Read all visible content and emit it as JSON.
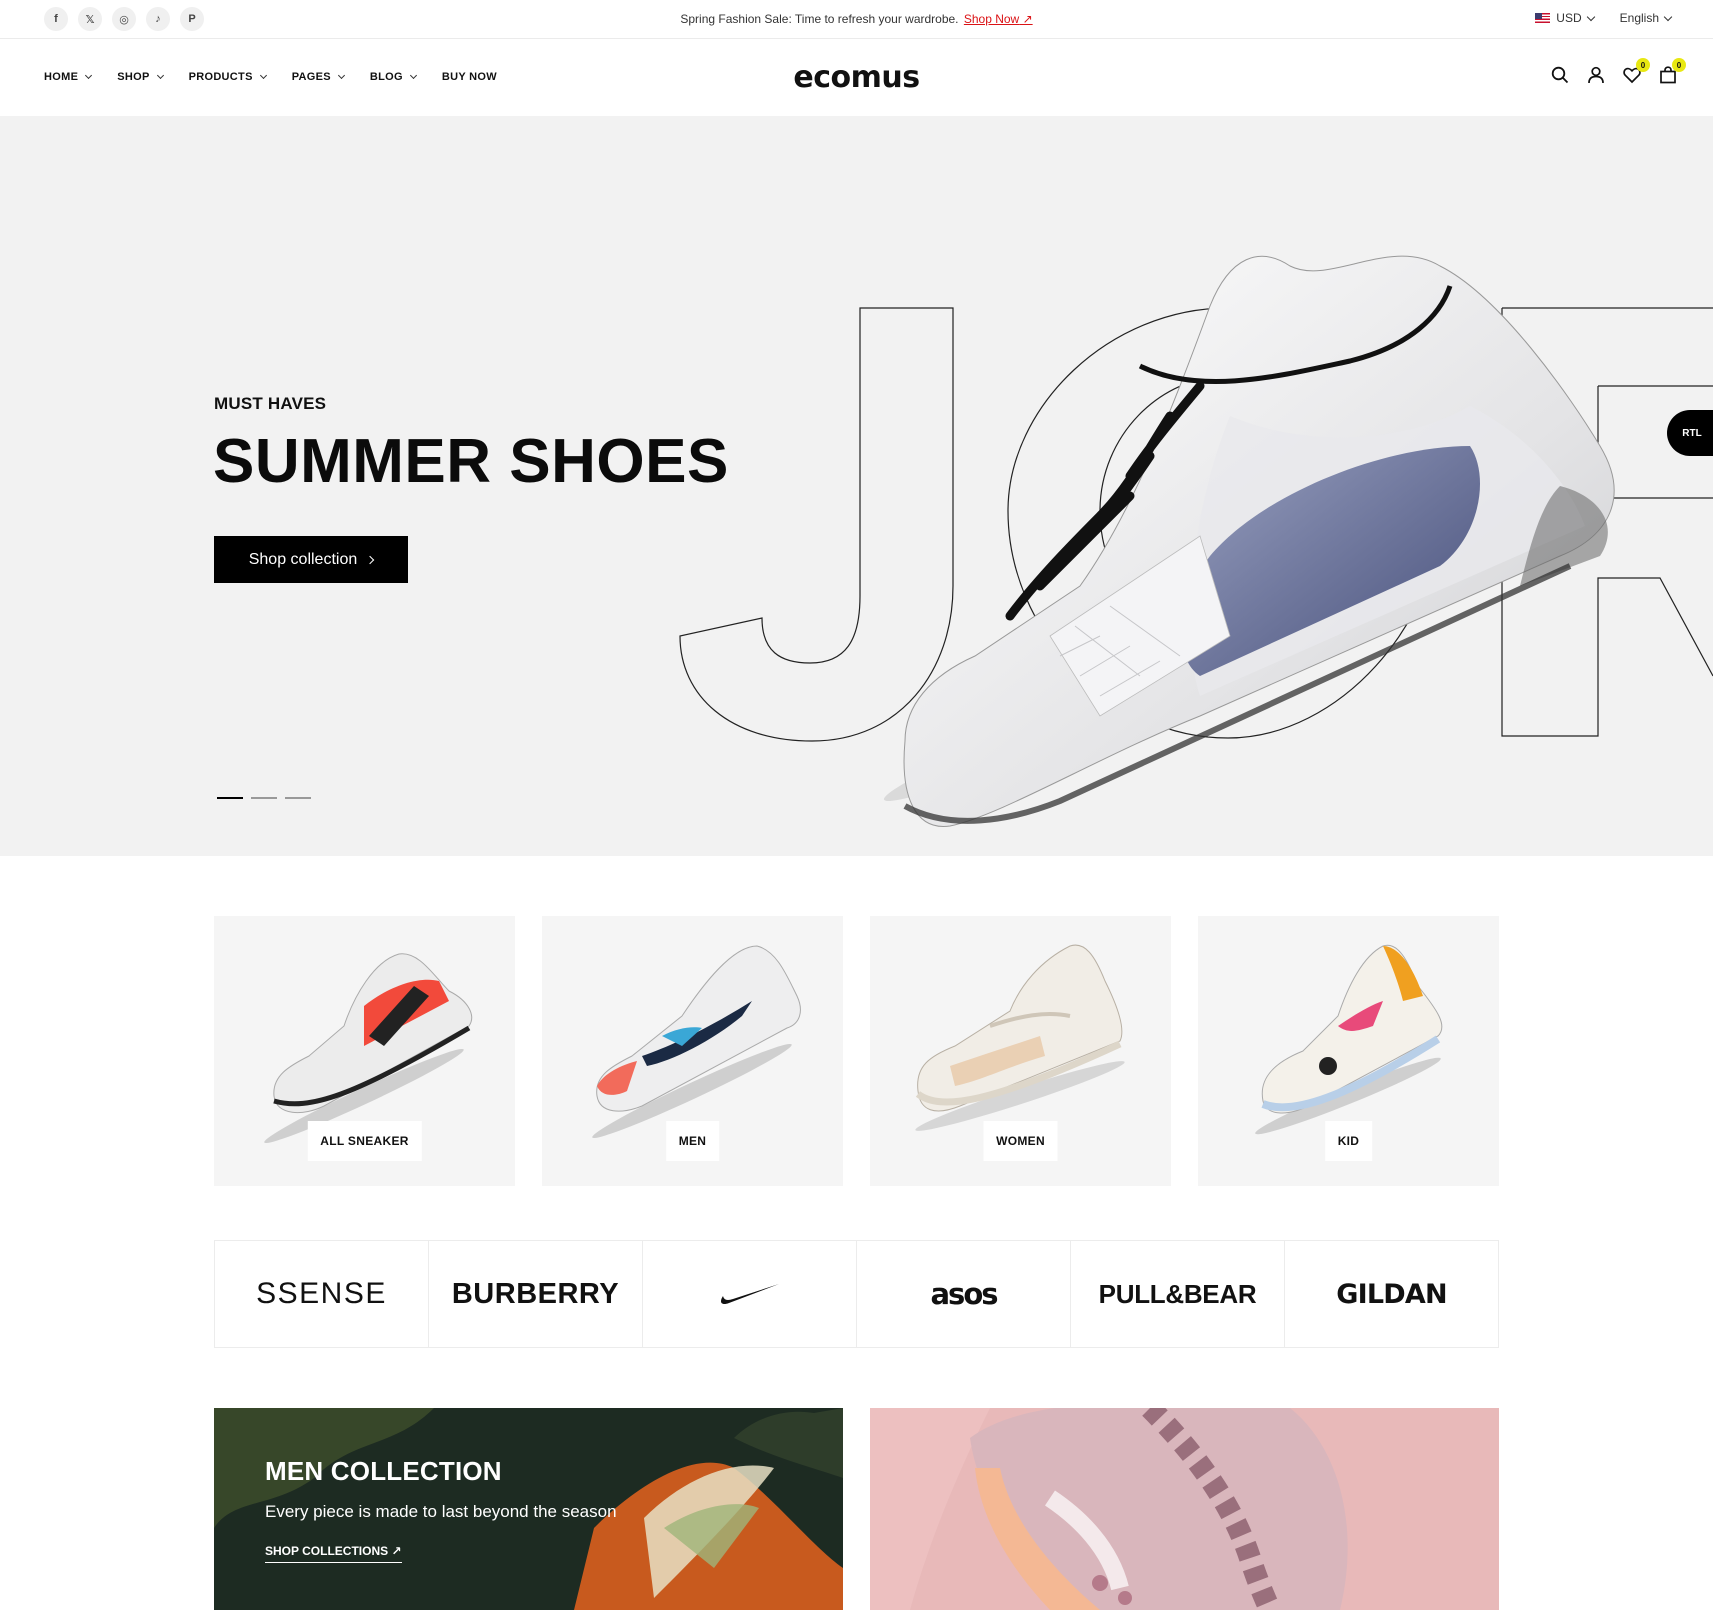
{
  "topbar": {
    "socials": [
      {
        "icon": "facebook-icon",
        "glyph": "f"
      },
      {
        "icon": "x-icon",
        "glyph": "𝕏"
      },
      {
        "icon": "instagram-icon",
        "glyph": "◎"
      },
      {
        "icon": "tiktok-icon",
        "glyph": "♪"
      },
      {
        "icon": "pinterest-icon",
        "glyph": "P"
      }
    ],
    "announcement": "Spring Fashion Sale: Time to refresh your wardrobe.",
    "announcement_link": "Shop Now",
    "currency": "USD",
    "language": "English"
  },
  "header": {
    "nav": [
      {
        "label": "HOME",
        "has_dropdown": true
      },
      {
        "label": "SHOP",
        "has_dropdown": true
      },
      {
        "label": "PRODUCTS",
        "has_dropdown": true
      },
      {
        "label": "PAGES",
        "has_dropdown": true
      },
      {
        "label": "BLOG",
        "has_dropdown": true
      },
      {
        "label": "BUY NOW",
        "has_dropdown": false
      }
    ],
    "logo": "ecomus",
    "wishlist_count": "0",
    "cart_count": "0"
  },
  "hero": {
    "subtitle": "MUST HAVES",
    "title": "SUMMER SHOES",
    "button": "Shop collection",
    "background_word": "JOR",
    "slides": 3,
    "active_slide": 1,
    "rtl_label": "RTL"
  },
  "categories": [
    {
      "label": "ALL SNEAKER",
      "accent": "#f24a3b"
    },
    {
      "label": "MEN",
      "accent": "#1b2a44"
    },
    {
      "label": "WOMEN",
      "accent": "#e8c8a8"
    },
    {
      "label": "KID",
      "accent": "#f0a020"
    }
  ],
  "brands": [
    "SSENSE",
    "BURBERRY",
    "nike-swoosh",
    "asos",
    "PULL&BEAR",
    "GILDAN"
  ],
  "banners": {
    "men": {
      "title": "MEN COLLECTION",
      "text": "Every piece is made to last beyond the season",
      "link": "SHOP COLLECTIONS"
    }
  },
  "colors": {
    "accent_red": "#db1215",
    "badge_yellow": "#e8e812",
    "hero_bg": "#f2f2f2",
    "category_bg": "#f5f5f5"
  }
}
